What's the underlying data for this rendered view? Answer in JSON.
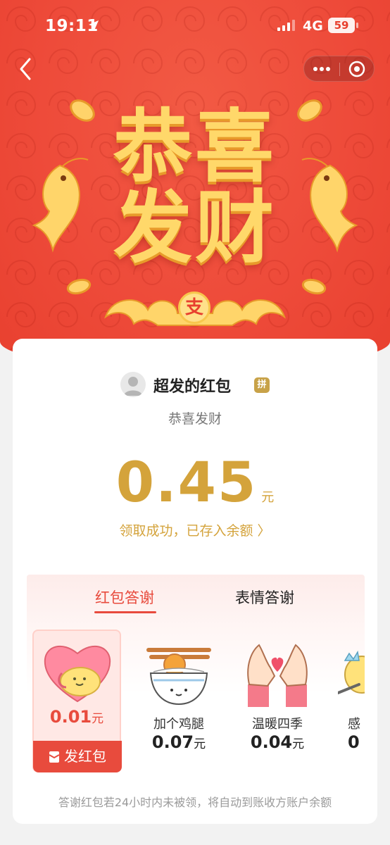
{
  "status_bar": {
    "time": "19:11",
    "network": "4G",
    "battery": "59"
  },
  "nav": {
    "back_icon": "chevron-left-icon",
    "more_icon": "more-dots-icon",
    "close_icon": "target-circle-icon"
  },
  "hero": {
    "title_line1": "恭喜",
    "title_line2": "发财",
    "logo_char": "支"
  },
  "card": {
    "sender_name": "超发的红包",
    "pin_badge": "拼",
    "blessing": "恭喜发财",
    "amount": "0.45",
    "unit": "元",
    "deposit_text": "领取成功，已存入余额 〉"
  },
  "thanks": {
    "tabs": [
      {
        "label": "红包答谢",
        "active": true
      },
      {
        "label": "表情答谢",
        "active": false
      }
    ],
    "selected": {
      "price": "0.01",
      "unit": "元",
      "send_label": "发红包"
    },
    "gifts": [
      {
        "name": "加个鸡腿",
        "price": "0.07",
        "unit": "元"
      },
      {
        "name": "温暖四季",
        "price": "0.04",
        "unit": "元"
      },
      {
        "name": "感",
        "price": "0",
        "unit": ""
      }
    ],
    "footnote": "答谢红包若24小时内未被领，将自动到账收方账户余额"
  },
  "colors": {
    "hero_red": "#ee4b3a",
    "gold": "#d4a33b",
    "accent_red": "#e84b3d"
  }
}
